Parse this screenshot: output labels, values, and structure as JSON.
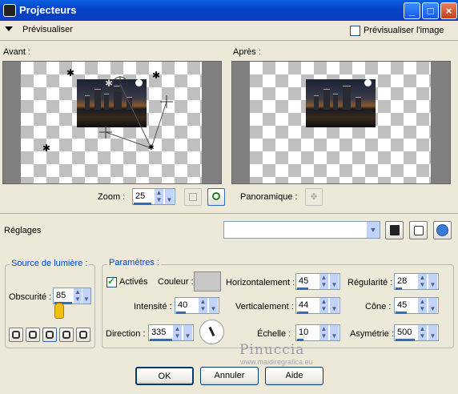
{
  "window": {
    "title": "Projecteurs"
  },
  "preview": {
    "previsualiser_label": "Prévisualiser",
    "previsualiser_image_label": "Prévisualiser l'image",
    "avant_label": "Avant :",
    "apres_label": "Après :"
  },
  "zoom": {
    "label": "Zoom :",
    "value": "25",
    "panoramique_label": "Panoramique :"
  },
  "reglages": {
    "label": "Réglages",
    "value": ""
  },
  "source": {
    "group_label": "Source de lumière :",
    "obscurite_label": "Obscurité :",
    "obscurite_value": "85"
  },
  "params": {
    "group_label": "Paramètres :",
    "actives_label": "Activés",
    "actives_checked": true,
    "couleur_label": "Couleur :",
    "couleur_value": "#c8c8c8",
    "intensite_label": "Intensité :",
    "intensite_value": "40",
    "direction_label": "Direction :",
    "direction_value": "335",
    "horizontalement_label": "Horizontalement :",
    "horizontalement_value": "45",
    "verticalement_label": "Verticalement :",
    "verticalement_value": "44",
    "echelle_label": "Échelle :",
    "echelle_value": "10",
    "regularite_label": "Régularité :",
    "regularite_value": "28",
    "cone_label": "Cône :",
    "cone_value": "45",
    "asymetrie_label": "Asymétrie :",
    "asymetrie_value": "500"
  },
  "watermark": {
    "name": "Pinuccia",
    "url": "www.maidiregrafica.eu"
  },
  "buttons": {
    "ok": "OK",
    "annuler": "Annuler",
    "aide": "Aide"
  }
}
